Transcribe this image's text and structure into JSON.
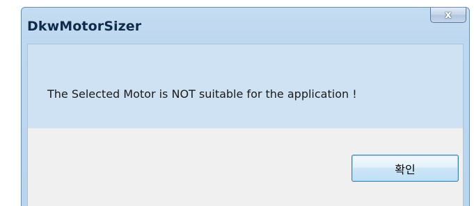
{
  "window": {
    "title": "DkwMotorSizer",
    "close_icon": "close-icon",
    "close_glyph": "x"
  },
  "dialog": {
    "message": "The Selected Motor is NOT suitable for the application !",
    "ok_label": "확인"
  },
  "colors": {
    "titlebar": "#bdd7ef",
    "message_area": "#cfe2f3",
    "button_area": "#f0f0f0",
    "button_border": "#3c7fb1"
  }
}
